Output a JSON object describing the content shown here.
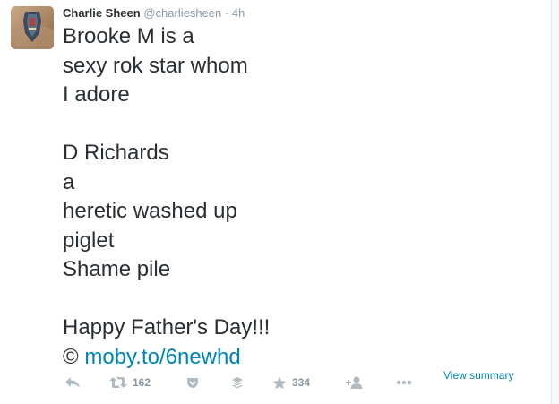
{
  "tweet": {
    "fullname": "Charlie Sheen",
    "username": "@charliesheen",
    "separator": "·",
    "timestamp": "4h",
    "lines": [
      "Brooke M is a",
      "sexy rok star whom",
      "I adore",
      "",
      "D Richards",
      "a",
      "heretic washed up",
      "piglet",
      "Shame pile",
      "",
      "Happy Father's Day!!!"
    ],
    "copyright_symbol": "©",
    "link_text": "moby.to/6newhd"
  },
  "actions": {
    "retweet_count": "162",
    "favorite_count": "334",
    "view_summary_label": "View summary"
  },
  "icons": {
    "reply": "reply-icon",
    "retweet": "retweet-icon",
    "pocket": "pocket-icon",
    "buffer": "buffer-icon",
    "favorite": "star-icon",
    "follow": "follow-icon",
    "more": "more-icon"
  },
  "colors": {
    "link": "#0084b4",
    "text": "#292f33",
    "muted": "#8899a6",
    "icon": "#b1bbc3"
  }
}
